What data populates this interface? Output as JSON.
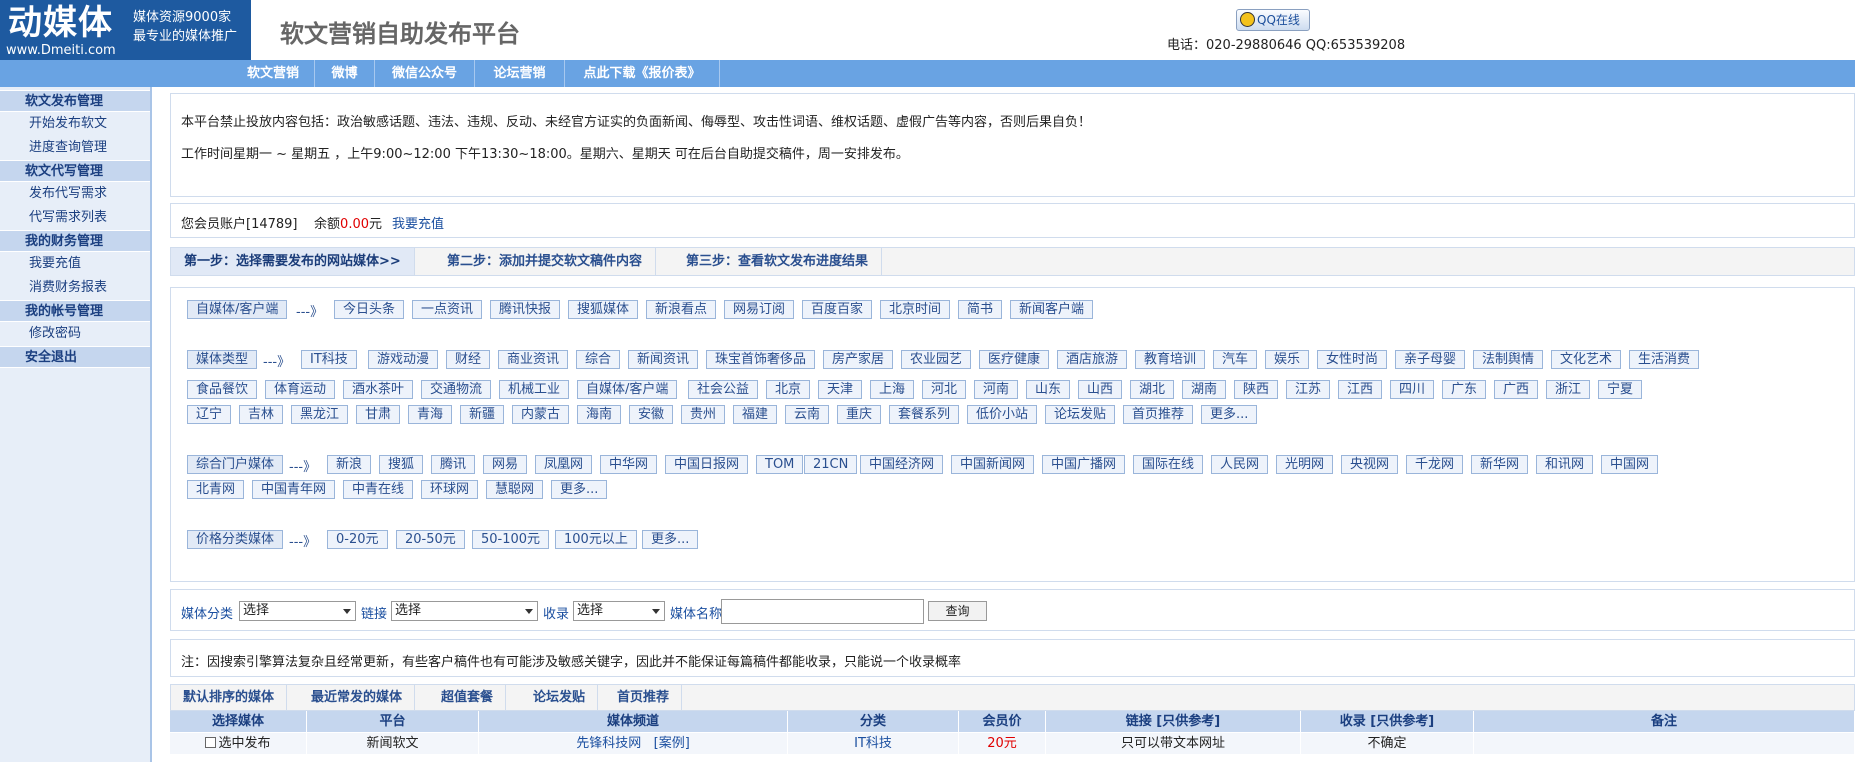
{
  "header": {
    "logo_big": "动媒体",
    "logo_url": "www.Dmeiti.com",
    "slogan_line1": "媒体资源9000家",
    "slogan_line2": "最专业的媒体推广",
    "site_title": "软文营销自助发布平台",
    "qq_button": "QQ在线",
    "contact": "电话：020-29880646 QQ:653539208"
  },
  "topnav": [
    "软文营销",
    "微博",
    "微信公众号",
    "论坛营销",
    "点此下载《报价表》"
  ],
  "sidebar": {
    "groups": [
      {
        "title": "软文发布管理",
        "items": [
          "开始发布软文",
          "进度查询管理"
        ]
      },
      {
        "title": "软文代写管理",
        "items": [
          "发布代写需求",
          "代写需求列表"
        ]
      },
      {
        "title": "我的财务管理",
        "items": [
          "我要充值",
          "消费财务报表"
        ]
      },
      {
        "title": "我的帐号管理",
        "items": [
          "修改密码"
        ]
      },
      {
        "title": "安全退出",
        "items": []
      }
    ]
  },
  "notice": {
    "line1": "本平台禁止投放内容包括：政治敏感话题、违法、违规、反动、未经官方证实的负面新闻、侮辱型、攻击性词语、维权话题、虚假广告等内容，否则后果自负！",
    "line2": "工作时间星期一 ~ 星期五 ，上午9:00~12:00 下午13:30~18:00。星期六、星期天 可在后台自助提交稿件，周一安排发布。"
  },
  "account": {
    "prefix": "您会员账户[14789]",
    "balance_label": "余额",
    "balance": "0.00",
    "unit": "元",
    "recharge": "我要充值"
  },
  "steps": [
    "第一步：选择需要发布的网站媒体>>",
    "第二步：添加并提交软文稿件内容",
    "第三步：查看软文发布进度结果"
  ],
  "media": {
    "arrow": "---》",
    "self_media": {
      "head": "自媒体/客户端",
      "items": [
        "今日头条",
        "一点资讯",
        "腾讯快报",
        "搜狐媒体",
        "新浪看点",
        "网易订阅",
        "百度百家",
        "北京时间",
        "简书",
        "新闻客户端"
      ]
    },
    "media_type": {
      "head": "媒体类型",
      "row1": [
        "IT科技",
        "游戏动漫",
        "财经",
        "商业资讯",
        "综合",
        "新闻资讯",
        "珠宝首饰奢侈品",
        "房产家居",
        "农业园艺",
        "医疗健康",
        "酒店旅游",
        "教育培训",
        "汽车",
        "娱乐",
        "女性时尚",
        "亲子母婴",
        "法制舆情",
        "文化艺术",
        "生活消费"
      ],
      "row2": [
        "食品餐饮",
        "体育运动",
        "酒水茶叶",
        "交通物流",
        "机械工业",
        "自媒体/客户端",
        "社会公益",
        "北京",
        "天津",
        "上海",
        "河北",
        "河南",
        "山东",
        "山西",
        "湖北",
        "湖南",
        "陕西",
        "江苏",
        "江西",
        "四川",
        "广东",
        "广西",
        "浙江",
        "宁夏"
      ],
      "row3": [
        "辽宁",
        "吉林",
        "黑龙江",
        "甘肃",
        "青海",
        "新疆",
        "内蒙古",
        "海南",
        "安徽",
        "贵州",
        "福建",
        "云南",
        "重庆",
        "套餐系列",
        "低价小站",
        "论坛发贴",
        "首页推荐",
        "更多..."
      ]
    },
    "portal": {
      "head": "综合门户媒体",
      "row1": [
        "新浪",
        "搜狐",
        "腾讯",
        "网易",
        "凤凰网",
        "中华网",
        "中国日报网",
        "TOM",
        "21CN",
        "中国经济网",
        "中国新闻网",
        "中国广播网",
        "国际在线",
        "人民网",
        "光明网",
        "央视网",
        "千龙网",
        "新华网",
        "和讯网",
        "中国网"
      ],
      "row2": [
        "北青网",
        "中国青年网",
        "中青在线",
        "环球网",
        "慧聪网",
        "更多..."
      ]
    },
    "price": {
      "head": "价格分类媒体",
      "items": [
        "0-20元",
        "20-50元",
        "50-100元",
        "100元以上",
        "更多..."
      ]
    }
  },
  "filter": {
    "category_label": "媒体分类",
    "category_value": "选择",
    "link_label": "链接",
    "link_value": "选择",
    "index_label": "收录",
    "index_value": "选择",
    "name_label": "媒体名称",
    "name_value": "",
    "search_button": "查询"
  },
  "note": "注：因搜索引擎算法复杂且经常更新，有些客户稿件也有可能涉及敏感关键字，因此并不能保证每篇稿件都能收录，只能说一个收录概率",
  "tabs": [
    "默认排序的媒体",
    "最近常发的媒体",
    "超值套餐",
    "论坛发贴",
    "首页推荐"
  ],
  "table": {
    "headers": [
      "选择媒体",
      "平台",
      "媒体频道",
      "分类",
      "会员价",
      "链接 [只供参考]",
      "收录 [只供参考]",
      "备注"
    ],
    "row": {
      "select": "选中发布",
      "platform": "新闻软文",
      "channel": "先锋科技网",
      "case": "[案例]",
      "category": "IT科技",
      "price": "20元",
      "link": "只可以带文本网址",
      "index": "不确定",
      "remark": ""
    }
  },
  "colors": {
    "brand": "#1e5aa0",
    "nav": "#69a3e3",
    "sidebar_group": "#c5d6ee",
    "price_red": "#e00000"
  }
}
